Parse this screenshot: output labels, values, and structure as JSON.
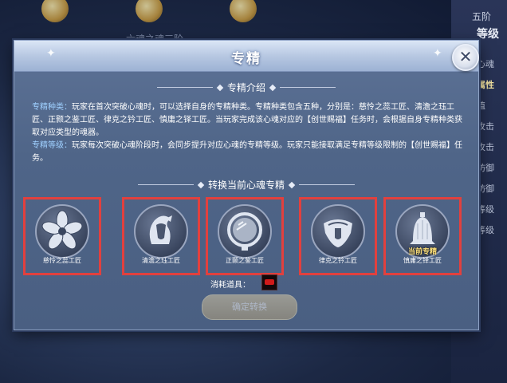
{
  "background": {
    "tier": "五阶",
    "level_label": "等级",
    "faded_title": "六魂之魂三阶",
    "side_list": [
      "当前心魂",
      "修炼属性",
      "生命值",
      "物理攻击",
      "法术攻击",
      "物理防御",
      "法术防御",
      "攻击等级",
      "防御等级",
      "气魄"
    ],
    "side_selected": 1
  },
  "dialog": {
    "title": "专精",
    "intro_heading": "专精介绍",
    "intro": {
      "kind_label": "专精种类：",
      "kind_text": "玩家在首次突破心魂时，可以选择自身的专精种类。专精种类包含五种，分别是：慈怜之蕊工匠、清澹之珏工匠、正颢之鉴工匠、律克之钤工匠、慎庸之铎工匠。当玩家完成该心魂对应的【创世赐福】任务时，会根据自身专精种类获取对应类型的魂器。",
      "level_label": "专精等级：",
      "level_text": "玩家每次突破心魂阶段时，会同步提升对应心魂的专精等级。玩家只能接取满足专精等级限制的【创世赐福】任务。"
    },
    "switch_heading": "转换当前心魂专精",
    "specialties": [
      {
        "name": "慈怜之蕊工匠",
        "icon": "flower-icon",
        "current": false
      },
      {
        "name": "清澹之珏工匠",
        "icon": "jade-mask-icon",
        "current": false
      },
      {
        "name": "正颢之鉴工匠",
        "icon": "mirror-icon",
        "current": false
      },
      {
        "name": "律克之钤工匠",
        "icon": "seal-icon",
        "current": false
      },
      {
        "name": "慎庸之铎工匠",
        "icon": "bell-icon",
        "current": true
      }
    ],
    "current_tag": "当前专精",
    "consume_label": "消耗道具：",
    "confirm_label": "确定转换"
  },
  "colors": {
    "highlight_border": "#e2403e",
    "current_tag": "#ffe17a",
    "intro_label": "#9fd0ff"
  }
}
